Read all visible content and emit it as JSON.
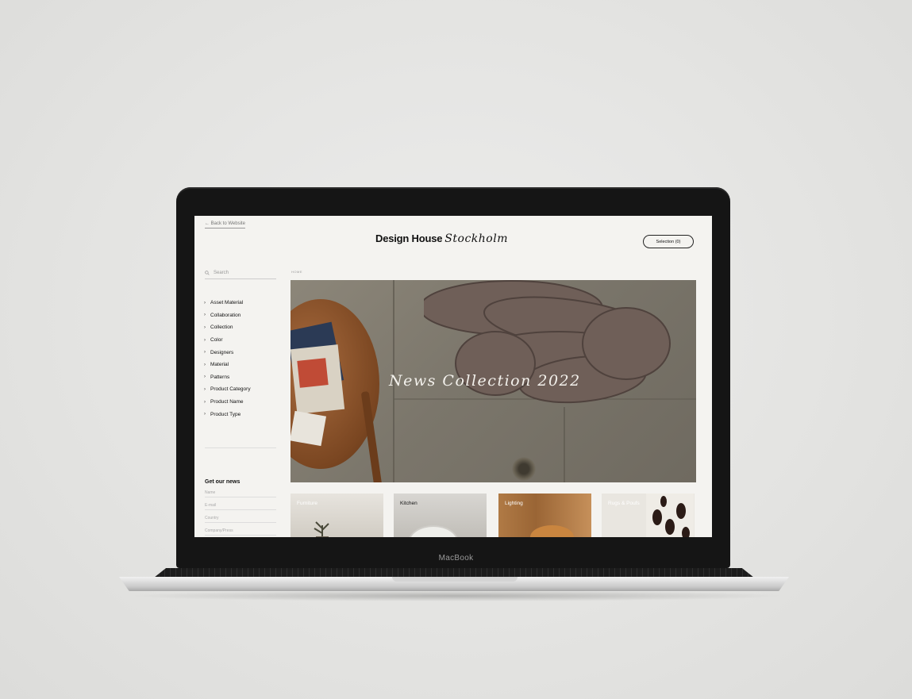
{
  "device": {
    "label": "MacBook"
  },
  "header": {
    "back_link": "← Back to Website",
    "brand_name": "Design House",
    "brand_script": "Stockholm",
    "selection_button": "Selection (0)"
  },
  "sidebar": {
    "search_placeholder": "Search",
    "filters": [
      "Asset Material",
      "Collaboration",
      "Collection",
      "Color",
      "Designers",
      "Material",
      "Patterns",
      "Product Category",
      "Product Name",
      "Product Type"
    ],
    "newsletter": {
      "title": "Get our news",
      "fields": [
        "Name",
        "E-mail",
        "Country",
        "Company/Press"
      ]
    }
  },
  "main": {
    "breadcrumb": "HOME",
    "hero_caption": "News Collection 2022",
    "categories": [
      "Furniture",
      "Kitchen",
      "Lighting",
      "Rugs & Poufs"
    ]
  },
  "colors": {
    "screen_bg": "#f4f3f0",
    "bezel": "#151515"
  }
}
